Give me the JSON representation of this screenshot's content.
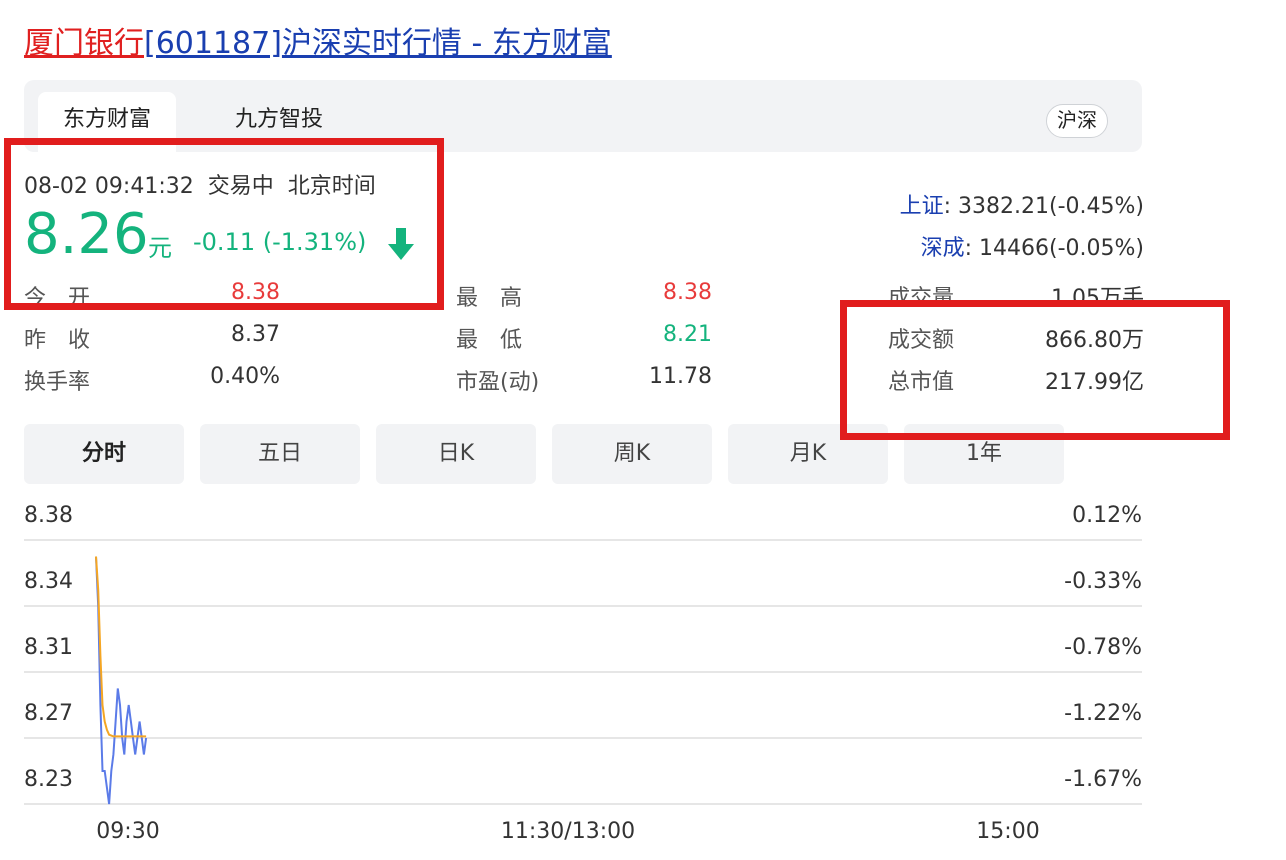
{
  "page": {
    "title_name": "厦门银行",
    "title_code": "[601187]",
    "title_rest": "沪深实时行情 - 东方财富"
  },
  "tabs": [
    {
      "label": "东方财富",
      "active": true
    },
    {
      "label": "九方智投",
      "active": false
    }
  ],
  "market_badge": "沪深",
  "quote": {
    "datetime": "08-02 09:41:32",
    "status": "交易中",
    "timezone": "北京时间",
    "price": "8.26",
    "unit": "元",
    "change": "-0.11 (-1.31%)",
    "direction": "down",
    "colors": {
      "up": "#e83b3b",
      "down": "#14b37d"
    }
  },
  "indices": [
    {
      "name": "上证",
      "value": ": 3382.21(-0.45%)"
    },
    {
      "name": "深成",
      "value": ": 14466(-0.05%)"
    }
  ],
  "stats": {
    "open_label": "今　开",
    "open": "8.38",
    "prev_label": "昨　收",
    "prev": "8.37",
    "turnover_rate_label": "换手率",
    "turnover_rate": "0.40%",
    "high_label": "最　高",
    "high": "8.38",
    "low_label": "最　低",
    "low": "8.21",
    "pe_label": "市盈(动)",
    "pe": "11.78",
    "volume_label": "成交量",
    "volume": "1.05万手",
    "amount_label": "成交额",
    "amount": "866.80万",
    "mcap_label": "总市值",
    "mcap": "217.99亿"
  },
  "period_tabs": [
    "分时",
    "五日",
    "日K",
    "周K",
    "月K",
    "1年"
  ],
  "active_period": "分时",
  "chart_data": {
    "type": "line",
    "title": "",
    "y_ticks": [
      "8.38",
      "8.34",
      "8.31",
      "8.27",
      "8.23"
    ],
    "y_right_ticks": [
      "0.12%",
      "-0.33%",
      "-0.78%",
      "-1.22%",
      "-1.67%"
    ],
    "x_ticks": [
      "09:30",
      "11:30/13:00",
      "15:00"
    ],
    "ylim": [
      8.22,
      8.38
    ],
    "x_minutes_total": 240,
    "series": [
      {
        "color": "#5b7be8",
        "x": [
          0,
          0.5,
          1,
          1.5,
          2,
          2.5,
          3,
          3.5,
          4,
          4.5,
          5,
          5.5,
          6,
          6.5,
          7,
          7.5,
          8,
          8.5,
          9,
          9.5,
          10,
          10.5,
          11,
          11.5
        ],
        "y": [
          8.37,
          8.34,
          8.28,
          8.24,
          8.24,
          8.23,
          8.22,
          8.24,
          8.25,
          8.27,
          8.29,
          8.28,
          8.26,
          8.25,
          8.27,
          8.28,
          8.27,
          8.26,
          8.25,
          8.26,
          8.27,
          8.26,
          8.25,
          8.26
        ]
      },
      {
        "color": "#f5a623",
        "x": [
          0,
          0.5,
          1,
          1.5,
          2,
          2.5,
          3,
          4,
          5,
          6,
          7,
          8,
          9,
          10,
          11,
          11.5
        ],
        "y": [
          8.37,
          8.35,
          8.31,
          8.28,
          8.27,
          8.265,
          8.262,
          8.261,
          8.261,
          8.261,
          8.261,
          8.261,
          8.261,
          8.261,
          8.261,
          8.261
        ]
      }
    ]
  }
}
